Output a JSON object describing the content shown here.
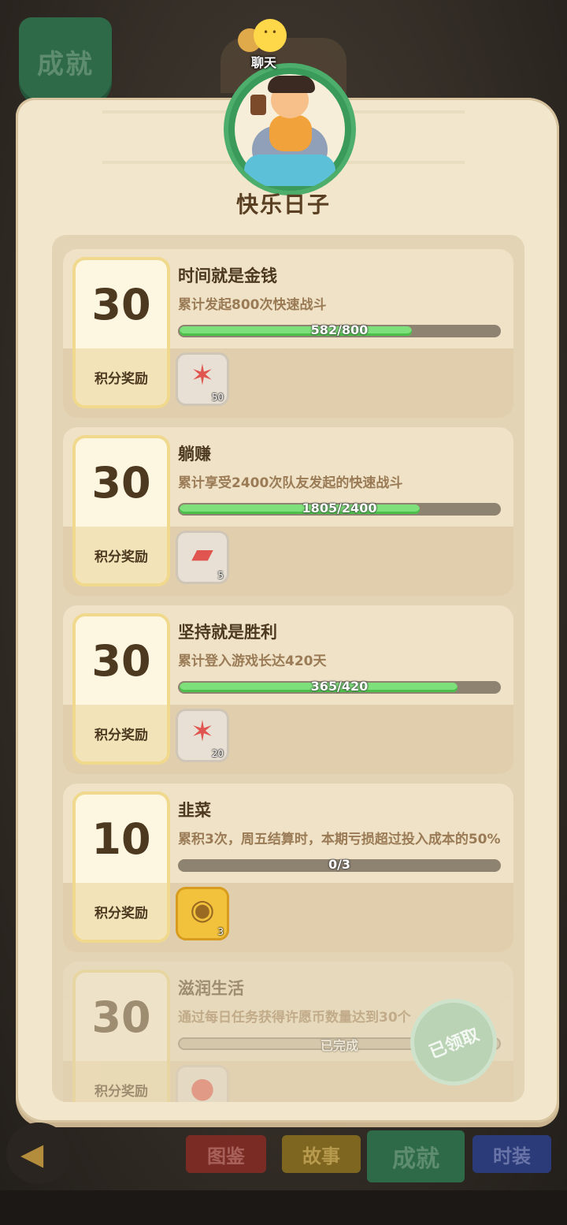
{
  "header": {
    "tab_label": "成就",
    "chat_label": "聊天",
    "title": "快乐日子"
  },
  "achievements": [
    {
      "points": "30",
      "points_label": "积分奖励",
      "name": "时间就是金钱",
      "description": "累计发起800次快速战斗",
      "progress_text": "582/800",
      "progress": 0.7275,
      "reward_icon": "starfish-icon",
      "reward_count": "50",
      "status": "in_progress"
    },
    {
      "points": "30",
      "points_label": "积分奖励",
      "name": "躺赚",
      "description": "累计享受2400次队友发起的快速战斗",
      "progress_text": "1805/2400",
      "progress": 0.752,
      "reward_icon": "ticket-icon",
      "reward_count": "5",
      "status": "in_progress"
    },
    {
      "points": "30",
      "points_label": "积分奖励",
      "name": "坚持就是胜利",
      "description": "累计登入游戏长达420天",
      "progress_text": "365/420",
      "progress": 0.869,
      "reward_icon": "starfish-icon",
      "reward_count": "20",
      "status": "in_progress"
    },
    {
      "points": "10",
      "points_label": "积分奖励",
      "name": "韭菜",
      "description": "累积3次，周五结算时，本期亏损超过投入成本的50%",
      "progress_text": "0/3",
      "progress": 0,
      "reward_icon": "treasure-icon",
      "reward_count": "3",
      "status": "in_progress"
    },
    {
      "points": "30",
      "points_label": "积分奖励",
      "name": "滋润生活",
      "description": "通过每日任务获得许愿币数量达到30个",
      "progress_text": "已完成",
      "progress": 1,
      "reward_icon": "coin-icon",
      "reward_count": "",
      "status": "claimed",
      "stamp_label": "已领取"
    }
  ],
  "bottom_nav": {
    "catalog": "图鉴",
    "story": "故事",
    "achievements": "成就",
    "outfit": "时装"
  },
  "colors": {
    "progress_fill": "#7ee07a",
    "progress_track": "#8e8270",
    "parchment": "#f2e6cc",
    "active_tab": "#2f6a48"
  }
}
